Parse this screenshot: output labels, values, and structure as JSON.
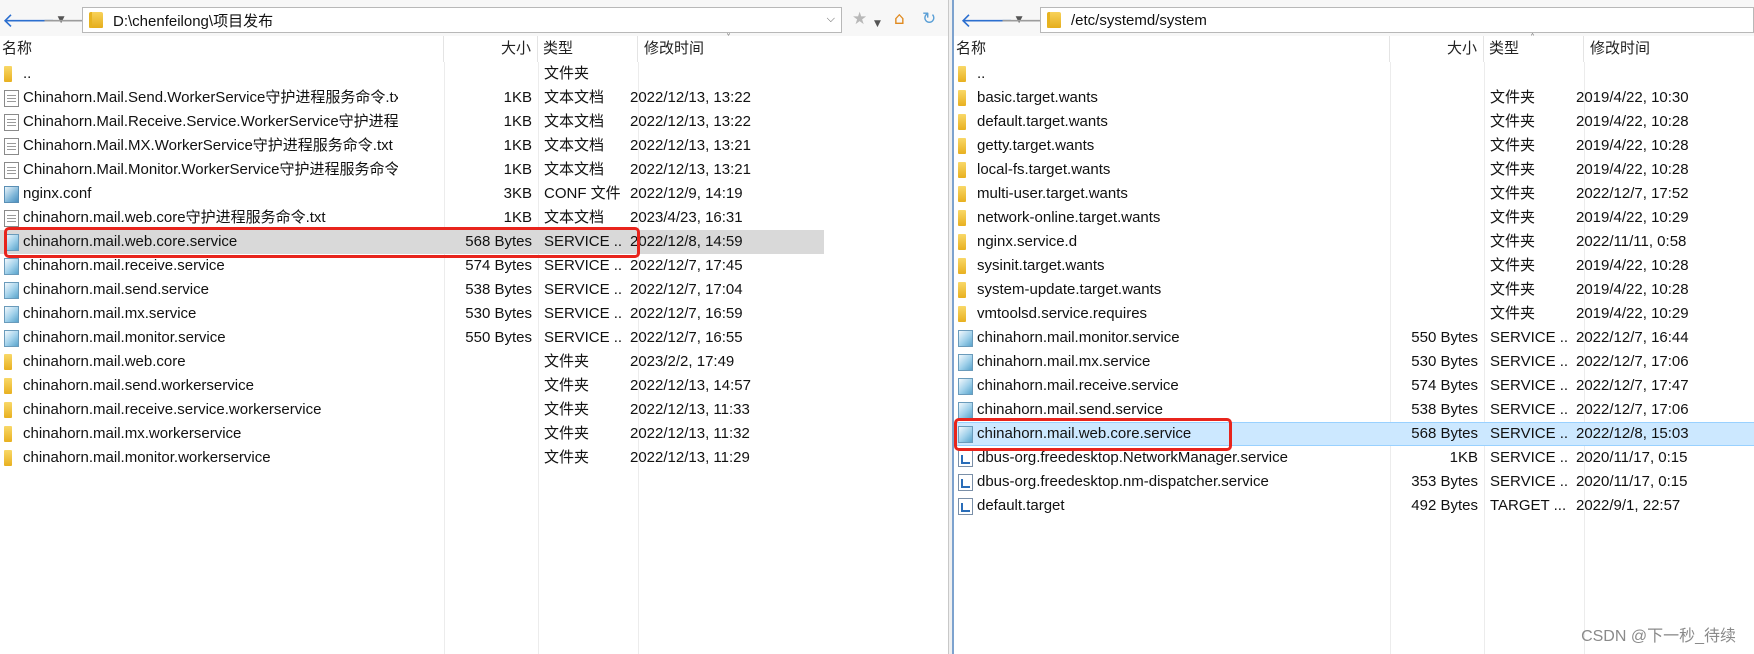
{
  "left": {
    "path": "D:\\chenfeilong\\项目发布",
    "columns": {
      "name": "名称",
      "size": "大小",
      "type": "类型",
      "date": "修改时间"
    },
    "sort_indicator": "˅",
    "files": [
      {
        "name": "..",
        "size": "",
        "type": "文件夹",
        "date": "",
        "icon": "folder-icon"
      },
      {
        "name": "Chinahorn.Mail.Send.WorkerService守护进程服务命令.txt",
        "size": "1KB",
        "type": "文本文档",
        "date": "2022/12/13, 13:22",
        "icon": "text-file-icon"
      },
      {
        "name": "Chinahorn.Mail.Receive.Service.WorkerService守护进程...",
        "size": "1KB",
        "type": "文本文档",
        "date": "2022/12/13, 13:22",
        "icon": "text-file-icon"
      },
      {
        "name": "Chinahorn.Mail.MX.WorkerService守护进程服务命令.txt",
        "size": "1KB",
        "type": "文本文档",
        "date": "2022/12/13, 13:21",
        "icon": "text-file-icon"
      },
      {
        "name": "Chinahorn.Mail.Monitor.WorkerService守护进程服务命令...",
        "size": "1KB",
        "type": "文本文档",
        "date": "2022/12/13, 13:21",
        "icon": "text-file-icon"
      },
      {
        "name": "nginx.conf",
        "size": "3KB",
        "type": "CONF 文件",
        "date": "2022/12/9, 14:19",
        "icon": "conf-file-icon"
      },
      {
        "name": "chinahorn.mail.web.core守护进程服务命令.txt",
        "size": "1KB",
        "type": "文本文档",
        "date": "2023/4/23, 16:31",
        "icon": "text-file-icon"
      },
      {
        "name": "chinahorn.mail.web.core.service",
        "size": "568 Bytes",
        "type": "SERVICE ...",
        "date": "2022/12/8, 14:59",
        "icon": "service-file-icon",
        "selected": true
      },
      {
        "name": "chinahorn.mail.receive.service",
        "size": "574 Bytes",
        "type": "SERVICE ...",
        "date": "2022/12/7, 17:45",
        "icon": "service-file-icon"
      },
      {
        "name": "chinahorn.mail.send.service",
        "size": "538 Bytes",
        "type": "SERVICE ...",
        "date": "2022/12/7, 17:04",
        "icon": "service-file-icon"
      },
      {
        "name": "chinahorn.mail.mx.service",
        "size": "530 Bytes",
        "type": "SERVICE ...",
        "date": "2022/12/7, 16:59",
        "icon": "service-file-icon"
      },
      {
        "name": "chinahorn.mail.monitor.service",
        "size": "550 Bytes",
        "type": "SERVICE ...",
        "date": "2022/12/7, 16:55",
        "icon": "service-file-icon"
      },
      {
        "name": "chinahorn.mail.web.core",
        "size": "",
        "type": "文件夹",
        "date": "2023/2/2, 17:49",
        "icon": "folder-icon"
      },
      {
        "name": "chinahorn.mail.send.workerservice",
        "size": "",
        "type": "文件夹",
        "date": "2022/12/13, 14:57",
        "icon": "folder-icon"
      },
      {
        "name": "chinahorn.mail.receive.service.workerservice",
        "size": "",
        "type": "文件夹",
        "date": "2022/12/13, 11:33",
        "icon": "folder-icon"
      },
      {
        "name": "chinahorn.mail.mx.workerservice",
        "size": "",
        "type": "文件夹",
        "date": "2022/12/13, 11:32",
        "icon": "folder-icon"
      },
      {
        "name": "chinahorn.mail.monitor.workerservice",
        "size": "",
        "type": "文件夹",
        "date": "2022/12/13, 11:29",
        "icon": "folder-icon"
      }
    ]
  },
  "right": {
    "path": "/etc/systemd/system",
    "columns": {
      "name": "名称",
      "size": "大小",
      "type": "类型",
      "date": "修改时间"
    },
    "sort_indicator": "˄",
    "files": [
      {
        "name": "..",
        "size": "",
        "type": "",
        "date": "",
        "icon": "folder-icon"
      },
      {
        "name": "basic.target.wants",
        "size": "",
        "type": "文件夹",
        "date": "2019/4/22, 10:30",
        "icon": "folder-icon"
      },
      {
        "name": "default.target.wants",
        "size": "",
        "type": "文件夹",
        "date": "2019/4/22, 10:28",
        "icon": "folder-icon"
      },
      {
        "name": "getty.target.wants",
        "size": "",
        "type": "文件夹",
        "date": "2019/4/22, 10:28",
        "icon": "folder-icon"
      },
      {
        "name": "local-fs.target.wants",
        "size": "",
        "type": "文件夹",
        "date": "2019/4/22, 10:28",
        "icon": "folder-icon"
      },
      {
        "name": "multi-user.target.wants",
        "size": "",
        "type": "文件夹",
        "date": "2022/12/7, 17:52",
        "icon": "folder-icon"
      },
      {
        "name": "network-online.target.wants",
        "size": "",
        "type": "文件夹",
        "date": "2019/4/22, 10:29",
        "icon": "folder-icon"
      },
      {
        "name": "nginx.service.d",
        "size": "",
        "type": "文件夹",
        "date": "2022/11/11, 0:58",
        "icon": "folder-icon"
      },
      {
        "name": "sysinit.target.wants",
        "size": "",
        "type": "文件夹",
        "date": "2019/4/22, 10:28",
        "icon": "folder-icon"
      },
      {
        "name": "system-update.target.wants",
        "size": "",
        "type": "文件夹",
        "date": "2019/4/22, 10:28",
        "icon": "folder-icon"
      },
      {
        "name": "vmtoolsd.service.requires",
        "size": "",
        "type": "文件夹",
        "date": "2019/4/22, 10:29",
        "icon": "folder-icon"
      },
      {
        "name": "chinahorn.mail.monitor.service",
        "size": "550 Bytes",
        "type": "SERVICE ...",
        "date": "2022/12/7, 16:44",
        "icon": "service-file-icon"
      },
      {
        "name": "chinahorn.mail.mx.service",
        "size": "530 Bytes",
        "type": "SERVICE ...",
        "date": "2022/12/7, 17:06",
        "icon": "service-file-icon"
      },
      {
        "name": "chinahorn.mail.receive.service",
        "size": "574 Bytes",
        "type": "SERVICE ...",
        "date": "2022/12/7, 17:47",
        "icon": "service-file-icon"
      },
      {
        "name": "chinahorn.mail.send.service",
        "size": "538 Bytes",
        "type": "SERVICE ...",
        "date": "2022/12/7, 17:06",
        "icon": "service-file-icon"
      },
      {
        "name": "chinahorn.mail.web.core.service",
        "size": "568 Bytes",
        "type": "SERVICE ...",
        "date": "2022/12/8, 15:03",
        "icon": "service-file-icon",
        "selected": true
      },
      {
        "name": "dbus-org.freedesktop.NetworkManager.service",
        "size": "1KB",
        "type": "SERVICE ...",
        "date": "2020/11/17, 0:15",
        "icon": "unit-link-icon"
      },
      {
        "name": "dbus-org.freedesktop.nm-dispatcher.service",
        "size": "353 Bytes",
        "type": "SERVICE ...",
        "date": "2020/11/17, 0:15",
        "icon": "unit-link-icon"
      },
      {
        "name": "default.target",
        "size": "492 Bytes",
        "type": "TARGET ...",
        "date": "2022/9/1, 22:57",
        "icon": "unit-link-icon"
      }
    ]
  },
  "watermark": "CSDN @下一秒_待续",
  "colors": {
    "highlight": "#e8241c",
    "selection_grey": "#d9d9d9",
    "selection_blue": "#cce8ff",
    "nav_blue": "#2c6fcf"
  }
}
